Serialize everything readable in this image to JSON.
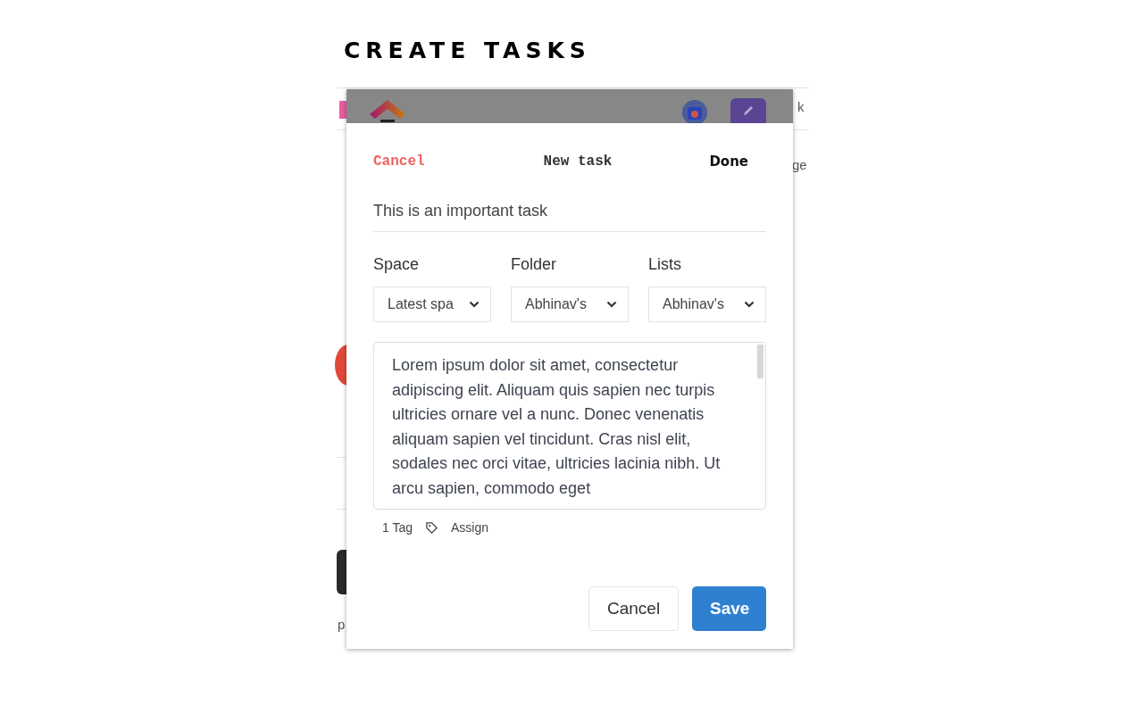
{
  "heading": "CREATE TASKS",
  "background": {
    "fragments": [
      "k",
      "ge",
      "p"
    ]
  },
  "dialog": {
    "cancel_link": "Cancel",
    "title": "New task",
    "done_link": "Done",
    "task_name": {
      "value": "This is an important task"
    },
    "selects": [
      {
        "label": "Space",
        "value": "Latest spa"
      },
      {
        "label": "Folder",
        "value": "Abhinav's"
      },
      {
        "label": "Lists",
        "value": "Abhinav's"
      }
    ],
    "description": {
      "value": "Lorem ipsum dolor sit amet, consectetur adipiscing elit. Aliquam quis sapien nec turpis ultricies ornare vel a nunc. Donec venenatis aliquam sapien vel tincidunt. Cras nisl elit, sodales nec orci vitae, ultricies lacinia nibh. Ut arcu sapien, commodo eget"
    },
    "tag_count": "1 Tag",
    "assign_label": "Assign",
    "buttons": [
      {
        "label": "Cancel",
        "kind": "secondary"
      },
      {
        "label": "Save",
        "kind": "primary"
      }
    ]
  }
}
